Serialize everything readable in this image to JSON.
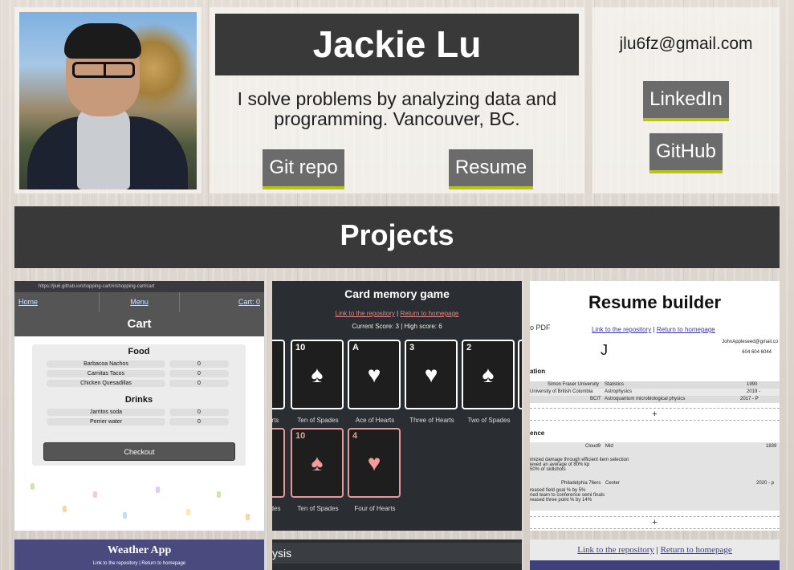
{
  "profile": {
    "name": "Jackie Lu",
    "tagline": "I solve problems by analyzing data and programming. Vancouver, BC.",
    "photo_alt": "profile-photo",
    "git_repo_label": "Git repo",
    "resume_label": "Resume",
    "email": "jlu6fz@gmail.com",
    "linkedin_label": "LinkedIn",
    "github_label": "GitHub",
    "button_accent": "#b8c414"
  },
  "projects": {
    "title": "Projects",
    "cart": {
      "url": "https://jlu6.github.io/shopping-cart/#/shopping-cart/cart",
      "nav": [
        "Home",
        "Menu",
        "Cart: 0"
      ],
      "header": "Cart",
      "sections": [
        {
          "name": "Food",
          "items": [
            {
              "label": "Barbacoa Nachos",
              "qty": "0"
            },
            {
              "label": "Carnitas Tacos",
              "qty": "0"
            },
            {
              "label": "Chicken Quesadillas",
              "qty": "0"
            }
          ]
        },
        {
          "name": "Drinks",
          "items": [
            {
              "label": "Jarritos soda",
              "qty": "0"
            },
            {
              "label": "Perrier water",
              "qty": "0"
            }
          ]
        }
      ],
      "checkout_label": "Checkout"
    },
    "memory": {
      "title": "Card memory game",
      "link_repo": "Link to the repository",
      "separator": "|",
      "link_home": "Return to homepage",
      "score": "Current Score: 3 | High score: 6",
      "row1": [
        {
          "rank": "",
          "label": "rts"
        },
        {
          "rank": "10",
          "label": "Ten of Spades"
        },
        {
          "rank": "A",
          "label": "Ace of Hearts"
        },
        {
          "rank": "3",
          "label": "Three of Hearts"
        },
        {
          "rank": "2",
          "label": "Two of Spades"
        }
      ],
      "row2": [
        {
          "rank": "",
          "label": "des"
        },
        {
          "rank": "10",
          "label": "Ten of Spades"
        },
        {
          "rank": "4",
          "label": "Four of Hearts"
        }
      ]
    },
    "resume_builder": {
      "title": "Resume builder",
      "pdf_label": "o PDF",
      "link_repo": "Link to the repository",
      "separator": "|",
      "link_home": "Return to homepage",
      "initial": "J",
      "email": "JohnAppleseed@gmail.co",
      "phone": "604 604 6044",
      "education_head": "ation",
      "education": [
        {
          "school": "Simon Fraser University",
          "field": "Statistics",
          "years": "1990"
        },
        {
          "school": "University of British Columbia",
          "field": "Astrophysics",
          "years": "2019 -"
        },
        {
          "school": "BCIT",
          "field": "Astroquantum microbiological physics",
          "years": "2017 - P"
        }
      ],
      "plus_label": "+",
      "experience_head": "ence",
      "experience": [
        {
          "company": "Cloud9",
          "role": "Mid",
          "years": "1839",
          "bullets": [
            "imized damage through efficient item selection",
            "ieved an average of 80% kp",
            "50% of skillshots"
          ]
        },
        {
          "company": "Philadelphia 76ers",
          "role": "Center",
          "years": "2020 - p",
          "bullets": [
            "reased field goal % by 5%",
            "ried team to conference semi finals",
            "reased three point % by 14%"
          ]
        }
      ]
    },
    "weather": {
      "title": "Weather App",
      "links": "Link to the repository | Return to homepage"
    },
    "analysis": {
      "title": "ysis"
    },
    "links_strip": {
      "link_repo": "Link to the repository",
      "separator": "|",
      "link_home": "Return to homepage"
    }
  }
}
